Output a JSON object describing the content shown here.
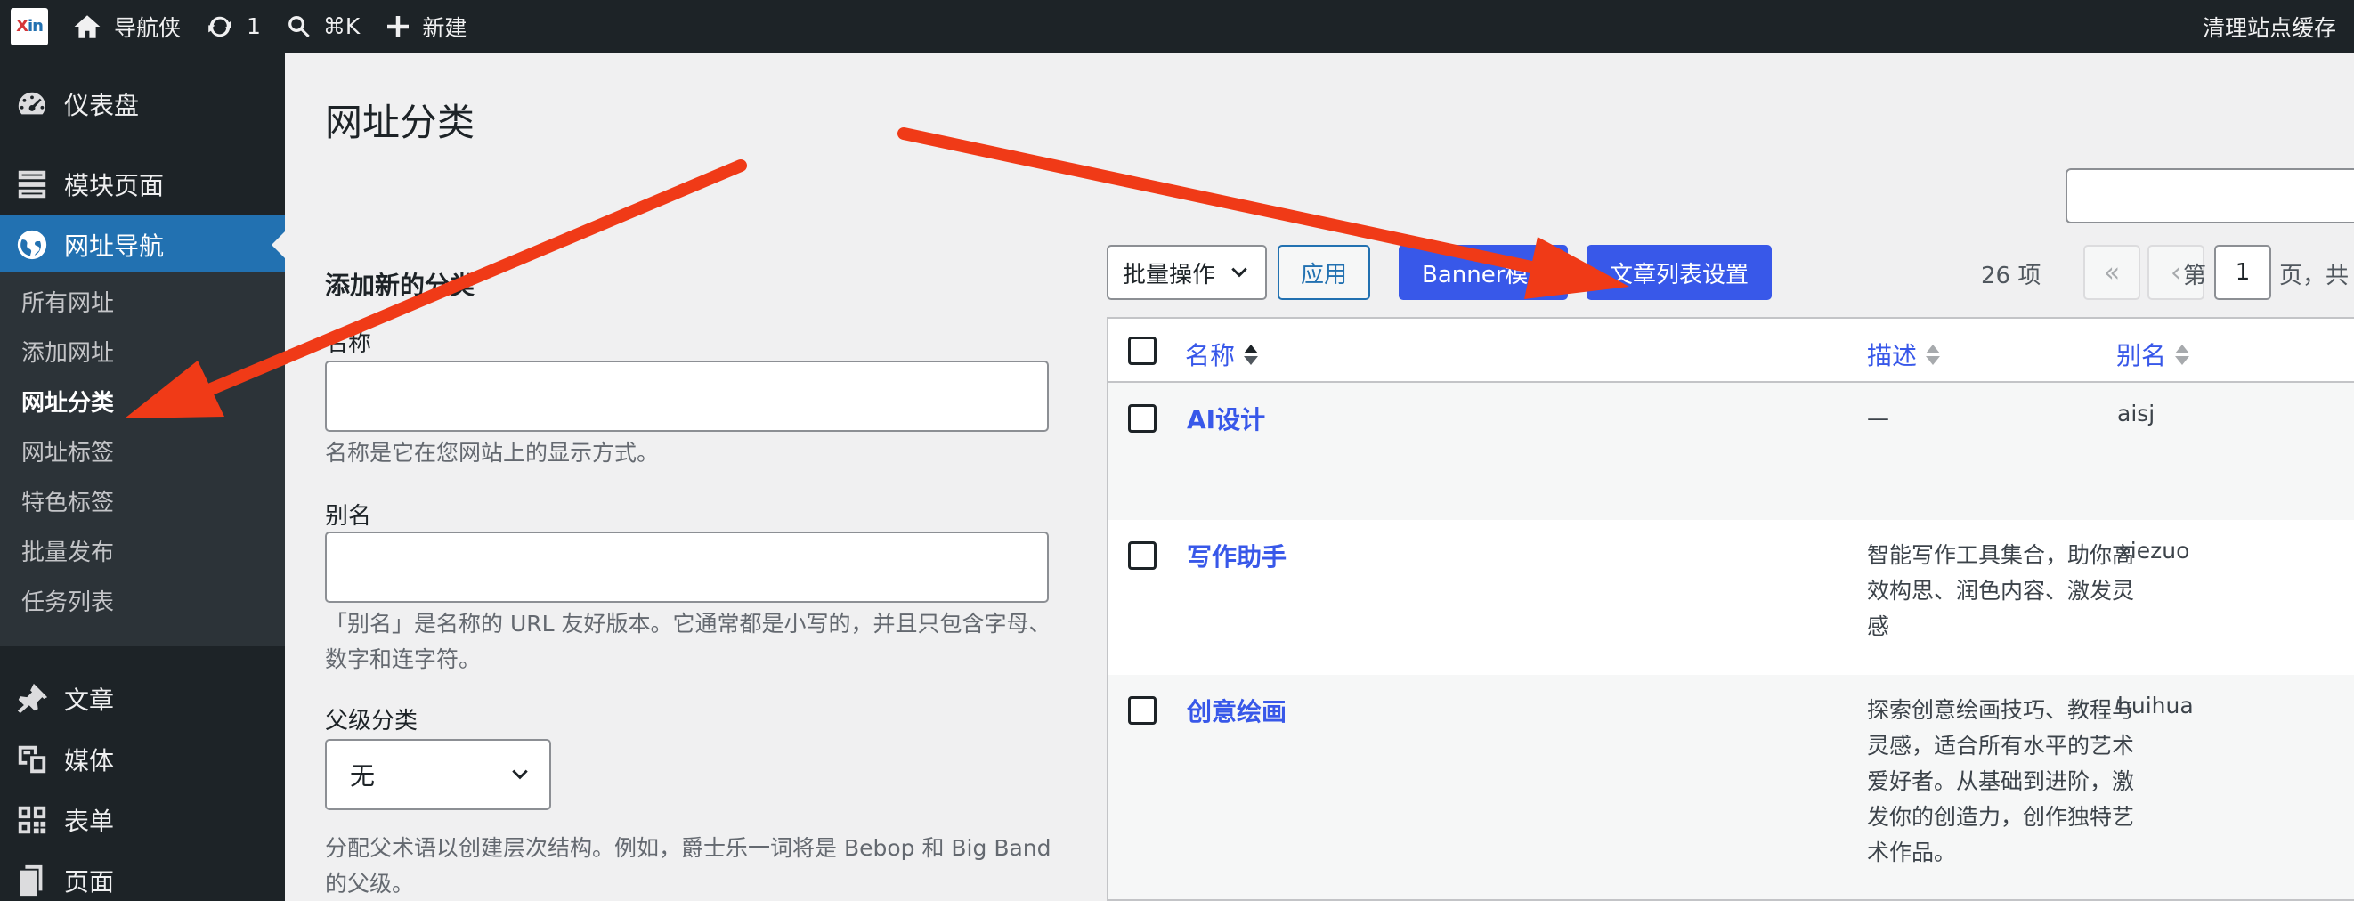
{
  "adminbar": {
    "site_name": "导航侠",
    "updates_count": "1",
    "search_shortcut": "⌘K",
    "new_label": "新建",
    "clear_cache": "清理站点缓存"
  },
  "sidebar": {
    "top_items": [
      {
        "label": "仪表盘",
        "icon": "dashboard-icon"
      },
      {
        "label": "模块页面",
        "icon": "layout-icon"
      },
      {
        "label": "网址导航",
        "icon": "globe-icon"
      }
    ],
    "submenu": [
      "所有网址",
      "添加网址",
      "网址分类",
      "网址标签",
      "特色标签",
      "批量发布",
      "任务列表"
    ],
    "bottom_items": [
      {
        "label": "文章",
        "icon": "pin-icon"
      },
      {
        "label": "媒体",
        "icon": "media-icon"
      },
      {
        "label": "表单",
        "icon": "forms-icon"
      },
      {
        "label": "页面",
        "icon": "page-icon"
      }
    ]
  },
  "page": {
    "title": "网址分类"
  },
  "form": {
    "heading": "添加新的分类",
    "name_label": "名称",
    "name_help": "名称是它在您网站上的显示方式。",
    "slug_label": "别名",
    "slug_help": "「别名」是名称的 URL 友好版本。它通常都是小写的，并且只包含字母、数字和连字符。",
    "parent_label": "父级分类",
    "parent_value": "无",
    "parent_help": "分配父术语以创建层次结构。例如，爵士乐一词将是 Bebop 和 Big Band 的父级。"
  },
  "toolbar": {
    "bulk_label": "批量操作",
    "apply_label": "应用",
    "banner_label": "Banner模板",
    "list_settings_label": "文章列表设置",
    "item_count": "26 项",
    "first_page": "«",
    "prev_page": "‹",
    "page_prefix": "第",
    "current_page": "1",
    "page_suffix": "页，共"
  },
  "table": {
    "headers": {
      "name": "名称",
      "description": "描述",
      "slug": "别名"
    },
    "rows": [
      {
        "name": "AI设计",
        "description": "—",
        "slug": "aisj"
      },
      {
        "name": "写作助手",
        "description": "智能写作工具集合，助你高效构思、润色内容、激发灵感",
        "slug": "xiezuo"
      },
      {
        "name": "创意绘画",
        "description": "探索创意绘画技巧、教程与灵感，适合所有水平的艺术爱好者。从基础到进阶，激发你的创造力，创作独特艺术作品。",
        "slug": "huihua"
      }
    ]
  },
  "colors": {
    "adminbar_bg": "#1d2327",
    "accent_blue": "#3858e9",
    "current_menu": "#2271b1",
    "arrow_red": "#f03a17"
  }
}
